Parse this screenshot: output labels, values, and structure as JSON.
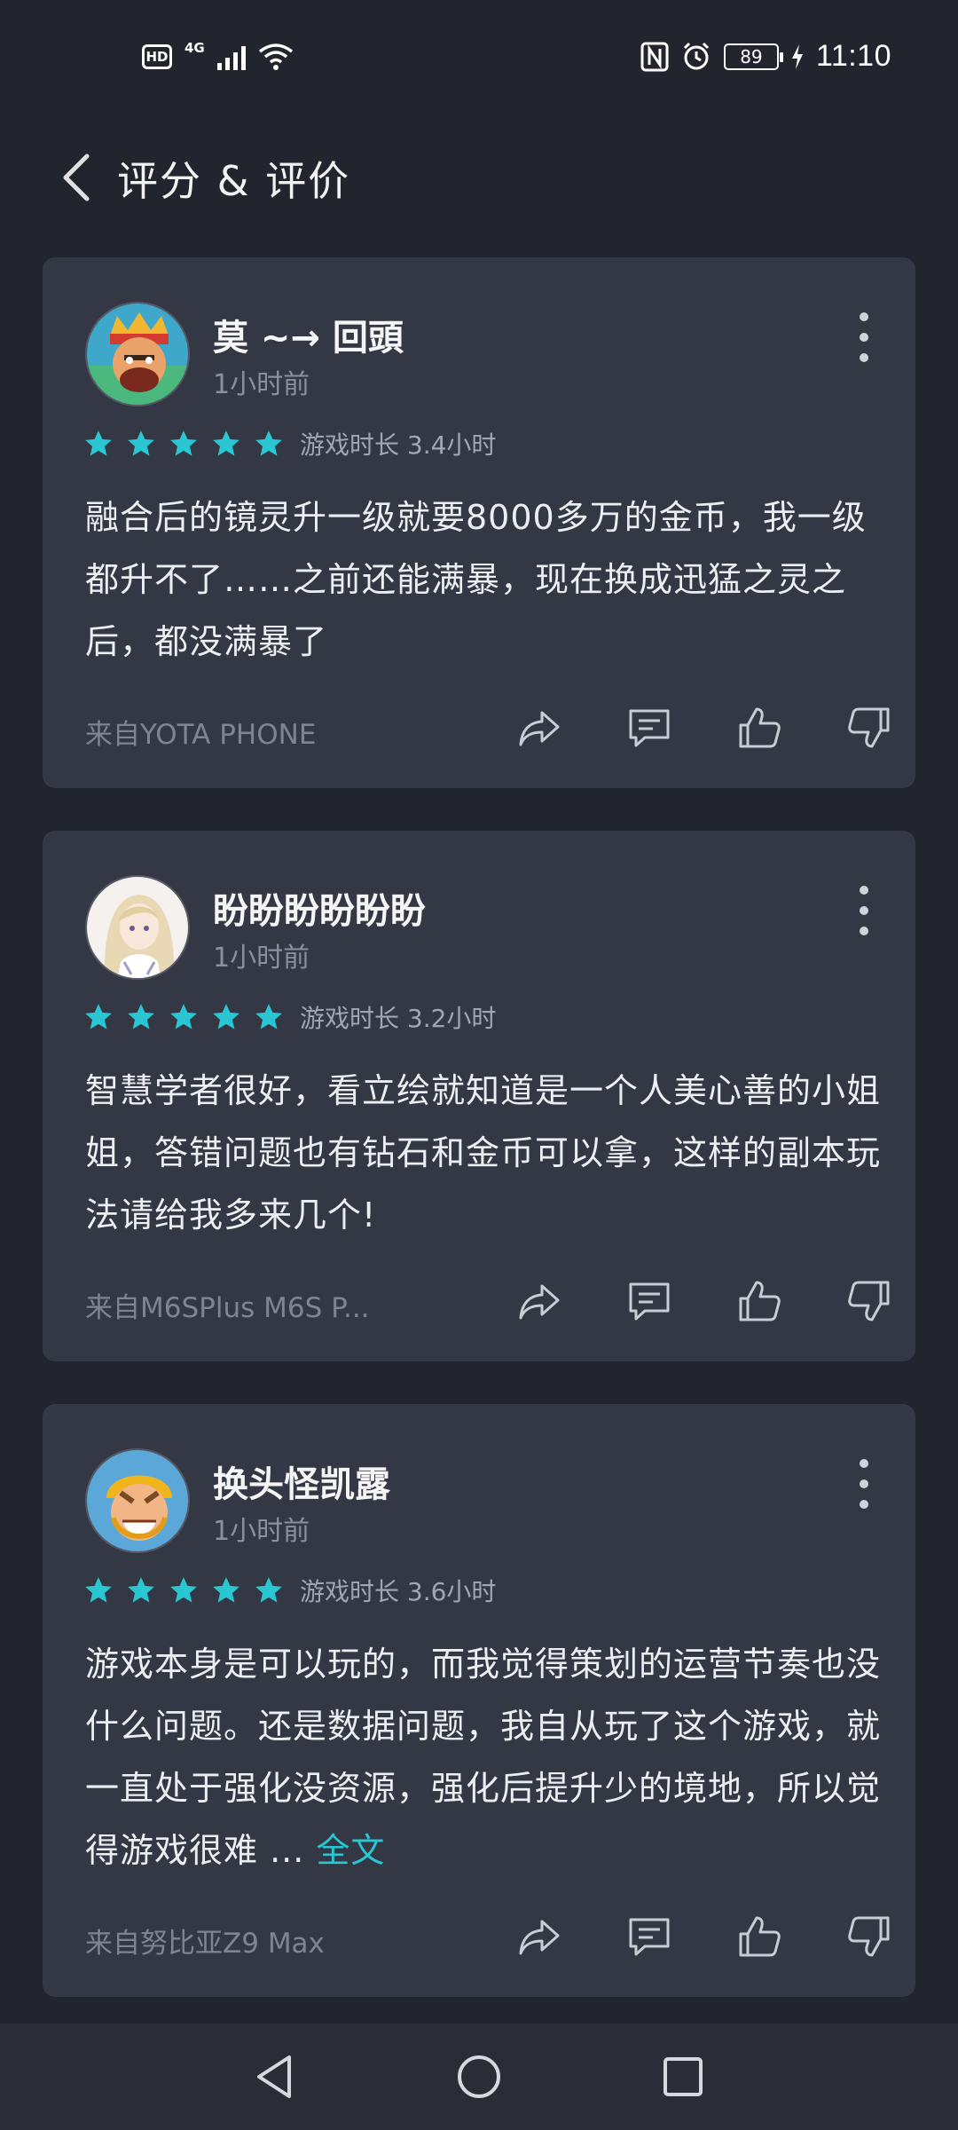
{
  "status_bar": {
    "hd": "HD",
    "network": "4G",
    "battery": "89",
    "time": "11:10"
  },
  "header": {
    "title": "评分 & 评价"
  },
  "reviews": [
    {
      "user": "莫 ~→ 回頭",
      "time": "1小时前",
      "rating": 5,
      "play_time": "游戏时长 3.4小时",
      "text": "融合后的镜灵升一级就要8000多万的金币，我一级都升不了……之前还能满暴，现在换成迅猛之灵之后，都没满暴了",
      "device": "来自YOTA PHONE",
      "avatar": "clash-royale-king-avatar"
    },
    {
      "user": "盼盼盼盼盼盼",
      "time": "1小时前",
      "rating": 5,
      "play_time": "游戏时长 3.2小时",
      "text": "智慧学者很好，看立绘就知道是一个人美心善的小姐姐，答错问题也有钻石和金币可以拿，这样的副本玩法请给我多来几个!",
      "device": "来自M6SPlus M6S P...",
      "avatar": "anime-girl-avatar"
    },
    {
      "user": "换头怪凯露",
      "time": "1小时前",
      "rating": 5,
      "play_time": "游戏时长 3.6小时",
      "text": "游戏本身是可以玩的，而我觉得策划的运营节奏也没什么问题。还是数据问题，我自从玩了这个游戏，就一直处于强化没资源，强化后提升少的境地，所以觉得游戏很难 ...",
      "more_link": "全文",
      "device": "来自努比亚Z9 Max",
      "avatar": "clash-of-clans-barbarian-avatar"
    }
  ],
  "colors": {
    "background": "#22252d",
    "card": "#333844",
    "accent": "#2bc6d4"
  }
}
